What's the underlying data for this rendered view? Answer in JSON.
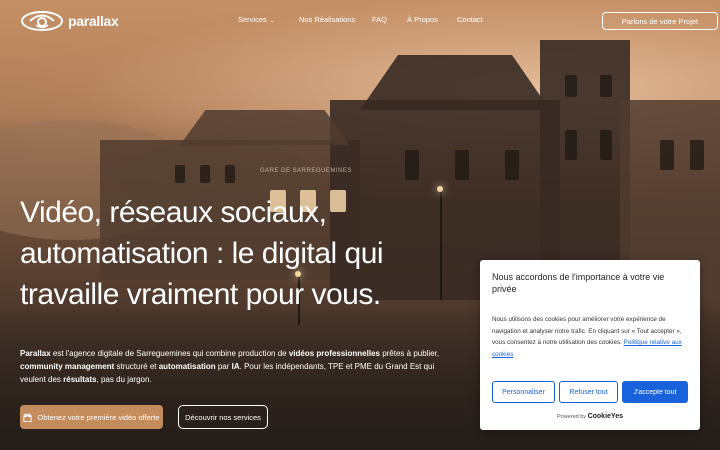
{
  "brand": {
    "name": "parallax",
    "accent": "#c48c5d",
    "logo_icon": "eye-swirl-logo-icon"
  },
  "nav": {
    "items": [
      {
        "label": "Services",
        "has_dropdown": true
      },
      {
        "label": "Nos Réalisations"
      },
      {
        "label": "FAQ"
      },
      {
        "label": "À Propos"
      },
      {
        "label": "Contact"
      }
    ],
    "cta_label": "Parlons de votre Projet"
  },
  "hero": {
    "station_sign": "GARE DE SARREGUEMINES",
    "headline_lines": [
      "Vidéo, réseaux sociaux,",
      "automatisation : le digital qui",
      "travaille vraiment pour vous."
    ],
    "intro": [
      {
        "text": "Parallax",
        "bold": true
      },
      {
        "text": " est l'agence digitale de Sarreguemines qui combine production de ",
        "bold": false
      },
      {
        "text": "vidéos professionnelles",
        "bold": true
      },
      {
        "text": " prêtes à publier, ",
        "bold": false
      },
      {
        "text": "community management",
        "bold": true
      },
      {
        "text": " structuré et ",
        "bold": false
      },
      {
        "text": "automatisation",
        "bold": true
      },
      {
        "text": " par ",
        "bold": false
      },
      {
        "text": "IA",
        "bold": true
      },
      {
        "text": ". Pour les indépendants, TPE et PME du Grand Est qui veulent des ",
        "bold": false
      },
      {
        "text": "résultats",
        "bold": true
      },
      {
        "text": ", pas du jargon.",
        "bold": false
      }
    ],
    "primary_button": "Obtenez votre première vidéo offerte",
    "primary_icon": "gift-icon",
    "secondary_button": "Découvrir nos services"
  },
  "cookie": {
    "title": "Nous accordons de l'importance à votre vie privée",
    "body": "Nous utilisons des cookies pour améliorer votre expérience de navigation et analyser notre trafic. En cliquant sur « Tout accepter », vous consentez à notre utilisation des cookies. ",
    "policy_link": "Politique relative aux cookies",
    "customize": "Personnaliser",
    "reject": "Refuser tout",
    "accept": "J'accepte tout",
    "powered_by": "Powered by",
    "powered_brand": "CookieYes",
    "accent": "#1863dc"
  }
}
